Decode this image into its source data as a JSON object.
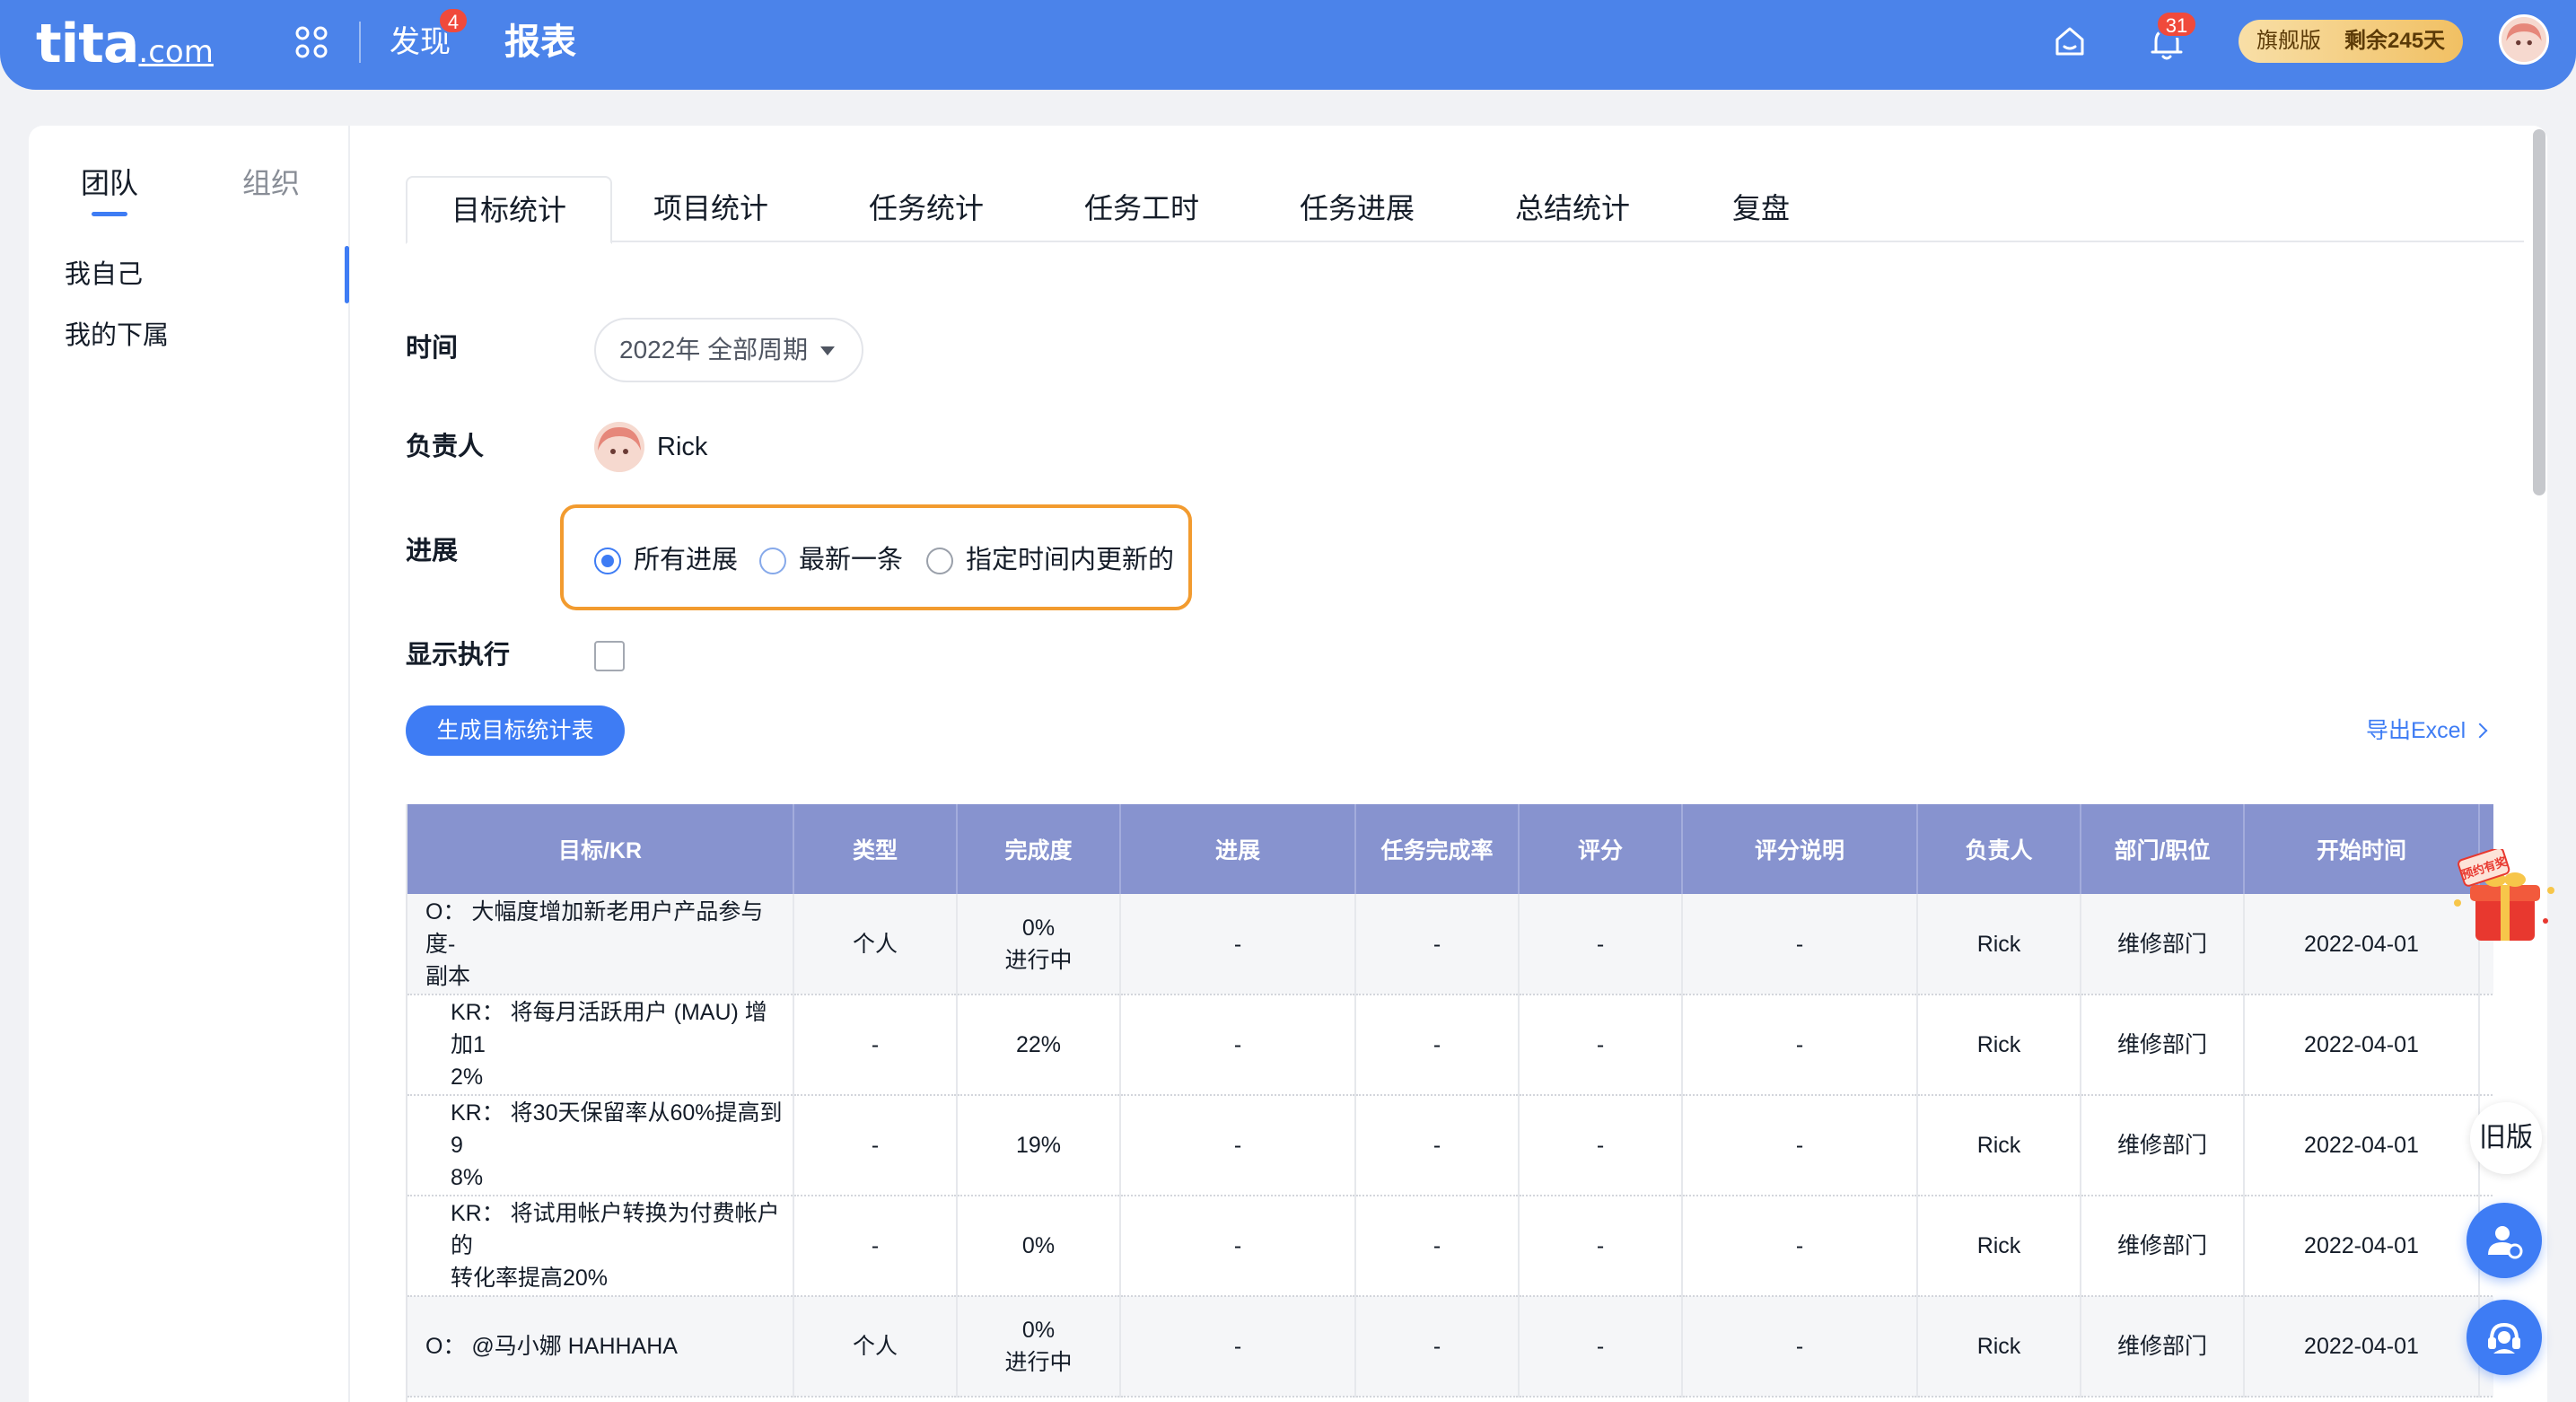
{
  "topbar": {
    "logo_main": "tita",
    "logo_suffix": ".com",
    "nav_discover": "发现",
    "discover_badge": "4",
    "nav_report": "报表",
    "bell_badge": "31",
    "plan_name": "旗舰版",
    "plan_remaining": "剩余245天"
  },
  "sidebar": {
    "tab_team": "团队",
    "tab_org": "组织",
    "items": [
      {
        "label": "我自己"
      },
      {
        "label": "我的下属"
      }
    ]
  },
  "tabs": [
    {
      "label": "目标统计"
    },
    {
      "label": "项目统计"
    },
    {
      "label": "任务统计"
    },
    {
      "label": "任务工时"
    },
    {
      "label": "任务进展"
    },
    {
      "label": "总结统计"
    },
    {
      "label": "复盘"
    }
  ],
  "form": {
    "time_label": "时间",
    "time_value": "2022年 全部周期",
    "owner_label": "负责人",
    "owner_name": "Rick",
    "progress_label": "进展",
    "progress_options": [
      {
        "label": "所有进展"
      },
      {
        "label": "最新一条"
      },
      {
        "label": "指定时间内更新的"
      }
    ],
    "show_exec_label": "显示执行",
    "generate_button": "生成目标统计表",
    "export_link": "导出Excel"
  },
  "table": {
    "headers": [
      "目标/KR",
      "类型",
      "完成度",
      "进展",
      "任务完成率",
      "评分",
      "评分说明",
      "负责人",
      "部门/职位",
      "开始时间"
    ],
    "rows": [
      {
        "goal_line1": "O：  大幅度增加新老用户产品参与度-",
        "goal_line2": "副本",
        "type": "个人",
        "done_line1": "0%",
        "done_line2": "进行中",
        "progress": "-",
        "task_rate": "-",
        "score": "-",
        "score_note": "-",
        "owner": "Rick",
        "dept": "维修部门",
        "start": "2022-04-01"
      },
      {
        "goal_line1": "KR：  将每月活跃用户 (MAU) 增加1",
        "goal_line2": "2%",
        "type": "-",
        "done_line1": "22%",
        "done_line2": "",
        "progress": "-",
        "task_rate": "-",
        "score": "-",
        "score_note": "-",
        "owner": "Rick",
        "dept": "维修部门",
        "start": "2022-04-01"
      },
      {
        "goal_line1": "KR：  将30天保留率从60%提高到9",
        "goal_line2": "8%",
        "type": "-",
        "done_line1": "19%",
        "done_line2": "",
        "progress": "-",
        "task_rate": "-",
        "score": "-",
        "score_note": "-",
        "owner": "Rick",
        "dept": "维修部门",
        "start": "2022-04-01"
      },
      {
        "goal_line1": "KR：  将试用帐户转换为付费帐户的",
        "goal_line2": "转化率提高20%",
        "type": "-",
        "done_line1": "0%",
        "done_line2": "",
        "progress": "-",
        "task_rate": "-",
        "score": "-",
        "score_note": "-",
        "owner": "Rick",
        "dept": "维修部门",
        "start": "2022-04-01"
      },
      {
        "goal_line1": "O：  @马小娜 HAHHAHA",
        "goal_line2": "",
        "type": "个人",
        "done_line1": "0%",
        "done_line2": "进行中",
        "progress": "-",
        "task_rate": "-",
        "score": "-",
        "score_note": "-",
        "owner": "Rick",
        "dept": "维修部门",
        "start": "2022-04-01"
      }
    ]
  },
  "floating": {
    "old_version": "旧版",
    "gift_text": "预约有奖"
  },
  "colors": {
    "brand_blue": "#4b83ea",
    "accent_blue": "#3e7cf4",
    "table_header": "#8793cf",
    "highlight_orange": "#f29b2f",
    "badge_red": "#f04a3c"
  }
}
